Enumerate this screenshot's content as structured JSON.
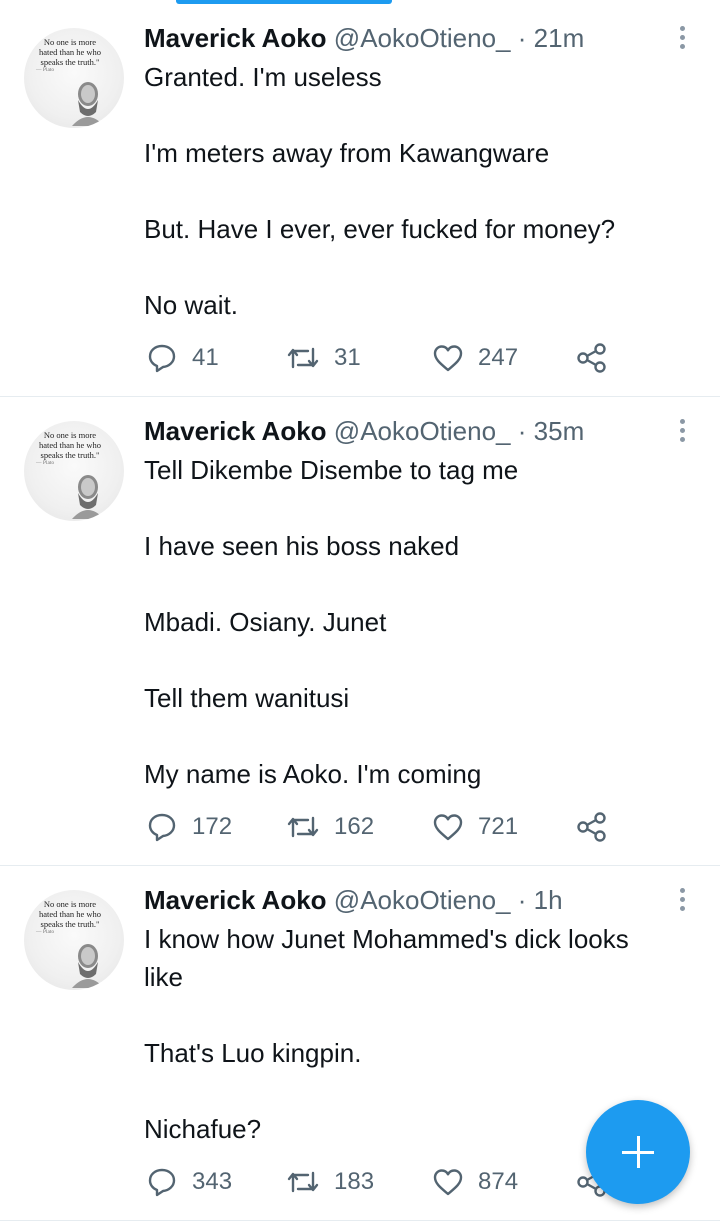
{
  "tweets": [
    {
      "name": "Maverick Aoko",
      "handle": "@AokoOtieno_",
      "dot": "·",
      "time": "21m",
      "lines": [
        "Granted. I'm useless",
        "I'm meters away from Kawangware",
        "But. Have I ever, ever fucked for money?",
        "No wait."
      ],
      "replies": "41",
      "retweets": "31",
      "likes": "247"
    },
    {
      "name": "Maverick Aoko",
      "handle": "@AokoOtieno_",
      "dot": "·",
      "time": "35m",
      "lines": [
        "Tell Dikembe Disembe to tag me",
        "I have seen his boss naked",
        "Mbadi. Osiany. Junet",
        "Tell them wanitusi",
        "My name is Aoko. I'm coming"
      ],
      "replies": "172",
      "retweets": "162",
      "likes": "721"
    },
    {
      "name": "Maverick Aoko",
      "handle": "@AokoOtieno_",
      "dot": "·",
      "time": "1h",
      "lines": [
        "I know how Junet Mohammed's dick looks",
        "like",
        "That's Luo kingpin.",
        "Nichafue?"
      ],
      "replies": "343",
      "retweets": "183",
      "likes": "874"
    }
  ],
  "avatar": {
    "quote_line1": "No one is more",
    "quote_line2": "hated than he who",
    "quote_line3": "speaks the truth.\"",
    "quote_author": "— Plato"
  },
  "colors": {
    "accent": "#1d9bf0",
    "text": "#0f1419",
    "secondary": "#536471",
    "divider": "#e6ecf0"
  },
  "icons": [
    "reply-icon",
    "retweet-icon",
    "like-icon",
    "share-icon",
    "more-options-icon",
    "compose-plus-icon"
  ]
}
